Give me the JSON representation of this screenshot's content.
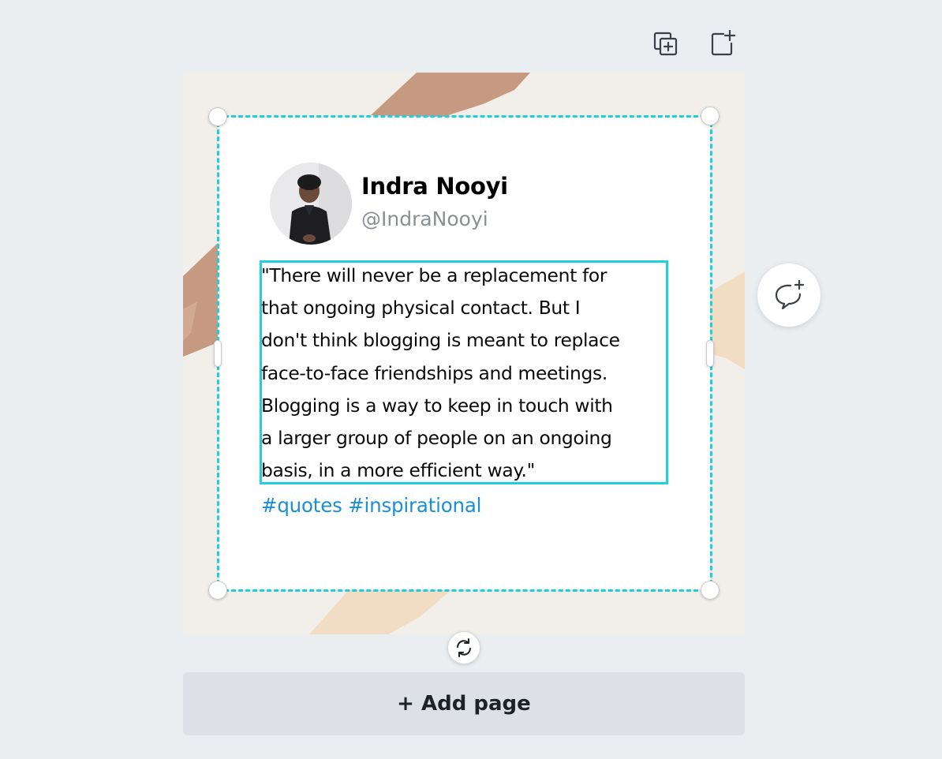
{
  "toolbar": {
    "duplicate_page_icon": "duplicate-page-icon",
    "add_page_icon": "add-page-icon"
  },
  "tweet": {
    "author_name": "Indra Nooyi",
    "author_handle": "@IndraNooyi",
    "quote_lines": [
      "\"There will never be a replacement for",
      "that ongoing physical contact. But I",
      "don't think blogging is meant to replace",
      "face-to-face friendships and meetings.",
      "Blogging is a way to keep in touch with",
      "a larger group of people on an ongoing",
      "basis, in a more efficient way.\""
    ],
    "hashtags": "#quotes #inspirational"
  },
  "actions": {
    "add_page_label": "+ Add page",
    "comment_icon": "add-comment-icon",
    "rotate_icon": "rotate-icon"
  },
  "colors": {
    "selection": "#1fd0dc",
    "hashtag": "#1a8fd6",
    "canvas_bg": "#ebeef1",
    "page_bg": "#f2eee9",
    "brush_dark": "#c59a80",
    "brush_light": "#f1dcc4"
  }
}
